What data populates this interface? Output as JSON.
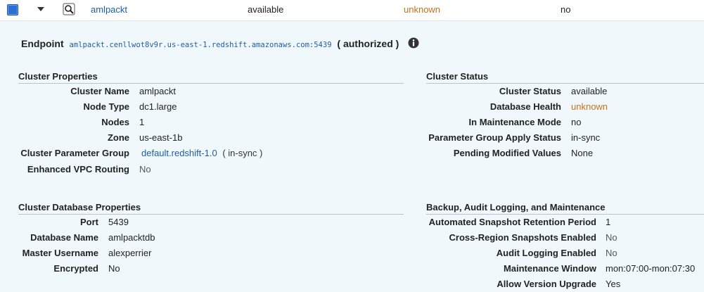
{
  "cluster_row": {
    "name": "amlpackt",
    "status": "available",
    "db_health": "unknown",
    "maintenance": "no"
  },
  "endpoint": {
    "label": "Endpoint",
    "url": "amlpackt.cenllwot8v9r.us-east-1.redshift.amazonaws.com:5439",
    "auth": "( authorized )"
  },
  "cluster_properties": {
    "title": "Cluster Properties",
    "items": [
      {
        "label": "Cluster Name",
        "value": "amlpackt"
      },
      {
        "label": "Node Type",
        "value": "dc1.large"
      },
      {
        "label": "Nodes",
        "value": "1"
      },
      {
        "label": "Zone",
        "value": "us-east-1b"
      },
      {
        "label": "Cluster Parameter Group",
        "value": "default.redshift-1.0",
        "extra": "( in-sync )"
      },
      {
        "label": "Enhanced VPC Routing",
        "value": "No"
      }
    ]
  },
  "cluster_status": {
    "title": "Cluster Status",
    "items": [
      {
        "label": "Cluster Status",
        "value": "available"
      },
      {
        "label": "Database Health",
        "value": "unknown"
      },
      {
        "label": "In Maintenance Mode",
        "value": "no"
      },
      {
        "label": "Parameter Group Apply Status",
        "value": "in-sync"
      },
      {
        "label": "Pending Modified Values",
        "value": "None"
      }
    ]
  },
  "database_properties": {
    "title": "Cluster Database Properties",
    "items": [
      {
        "label": "Port",
        "value": "5439"
      },
      {
        "label": "Database Name",
        "value": "amlpacktdb"
      },
      {
        "label": "Master Username",
        "value": "alexperrier"
      },
      {
        "label": "Encrypted",
        "value": "No"
      }
    ]
  },
  "backup": {
    "title": "Backup, Audit Logging, and Maintenance",
    "items": [
      {
        "label": "Automated Snapshot Retention Period",
        "value": "1"
      },
      {
        "label": "Cross-Region Snapshots Enabled",
        "value": "No"
      },
      {
        "label": "Audit Logging Enabled",
        "value": "No"
      },
      {
        "label": "Maintenance Window",
        "value": "mon:07:00-mon:07:30"
      },
      {
        "label": "Allow Version Upgrade",
        "value": "Yes"
      }
    ]
  },
  "colors": {
    "link": "#1c5ea8",
    "warning": "#c8701c",
    "panel_bg": "#f1f8fc",
    "checkbox": "#2c6fcf"
  },
  "icons": {
    "expand": "chevron-down-icon",
    "zoom": "magnifier-icon",
    "info": "info-icon"
  }
}
